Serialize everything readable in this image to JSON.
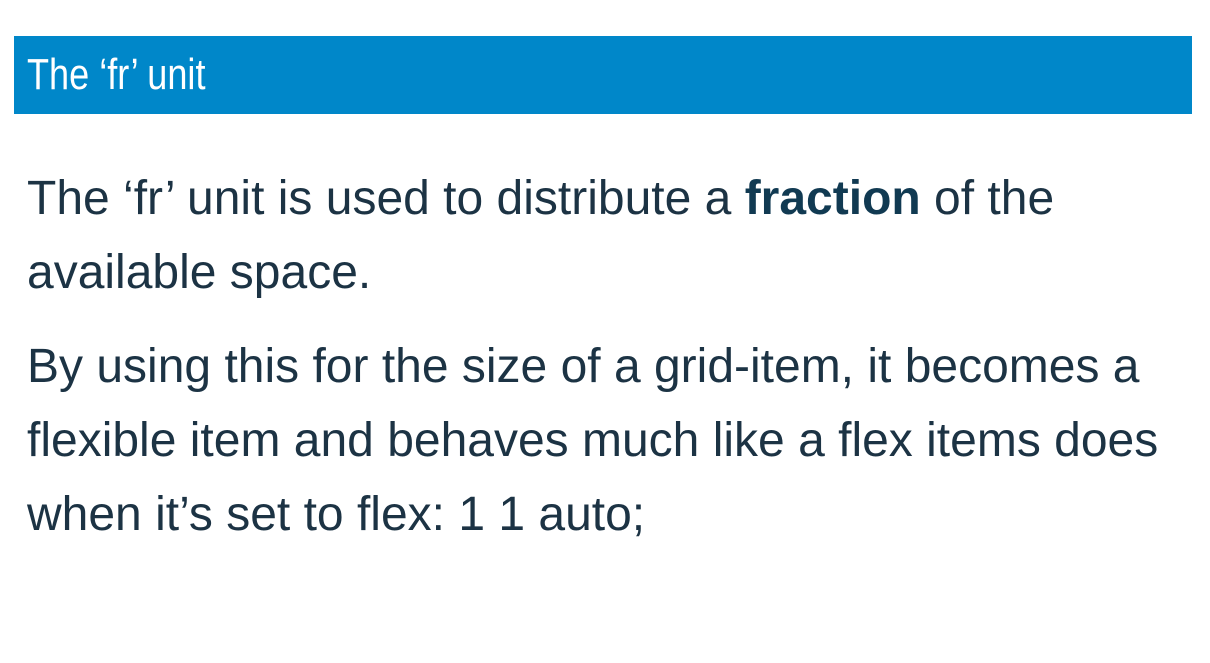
{
  "title": "The ‘fr’ unit",
  "paragraph1": {
    "before": "The ‘fr’ unit is used to distribute a ",
    "emphasis": "fraction",
    "after": " of the available space."
  },
  "paragraph2": {
    "text": "By using this for the size of a grid-item, it becomes a flexible item and behaves much like a flex items does when it’s set to flex: 1 1 auto;"
  },
  "colors": {
    "title_bar": "#0087c9",
    "title_text": "#ffffff",
    "body_text": "#1c3344"
  }
}
